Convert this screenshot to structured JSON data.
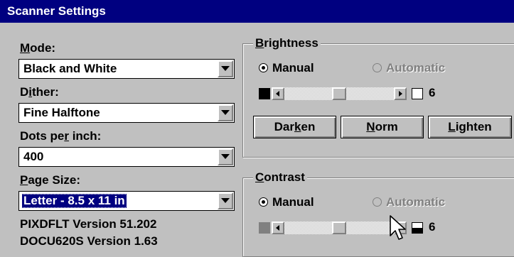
{
  "window": {
    "title": "Scanner Settings"
  },
  "left": {
    "mode": {
      "label_pre": "",
      "label_key": "M",
      "label_post": "ode:",
      "value": "Black and White"
    },
    "dither": {
      "label_pre": "D",
      "label_key": "i",
      "label_post": "ther:",
      "value": "Fine Halftone"
    },
    "dpi": {
      "label_pre": "Dots pe",
      "label_key": "r",
      "label_post": " inch:",
      "value": "400"
    },
    "page_size": {
      "label_pre": "",
      "label_key": "P",
      "label_post": "age Size:",
      "value": "Letter - 8.5 x 11 in"
    },
    "version1": "PIXDFLT Version 51.202",
    "version2": "DOCU620S Version  1.63"
  },
  "brightness": {
    "title_key": "B",
    "title_rest": "rightness",
    "manual_label": "Manual",
    "automatic_label": "Automatic",
    "selected": "manual",
    "value": "6",
    "slider_level": 0.5,
    "buttons": {
      "darken": {
        "pre": "Dar",
        "key": "k",
        "post": "en"
      },
      "norm": {
        "pre": "",
        "key": "N",
        "post": "orm"
      },
      "lighten": {
        "pre": "",
        "key": "L",
        "post": "ighten"
      }
    }
  },
  "contrast": {
    "title_key": "C",
    "title_rest": "ontrast",
    "manual_label": "Manual",
    "automatic_label": "Automatic",
    "selected": "manual",
    "value": "6",
    "slider_level": 0.5
  },
  "colors": {
    "titlebar": "#000080",
    "face": "#c0c0c0",
    "selection": "#000080"
  }
}
